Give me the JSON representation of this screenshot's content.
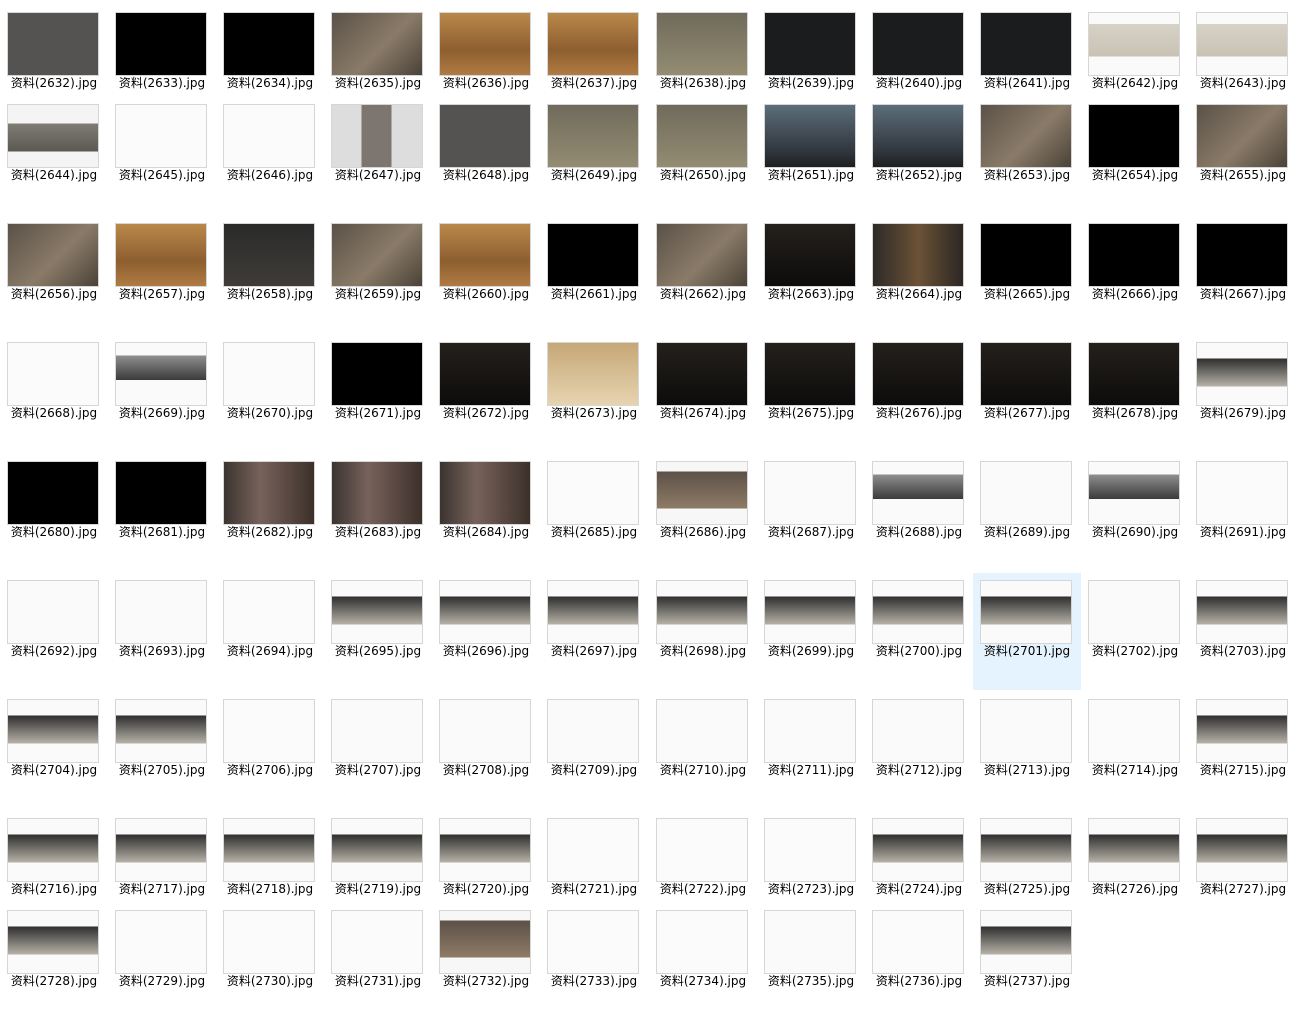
{
  "file_list": {
    "items": [
      {
        "name": "资料(2632).jpg",
        "thumb": "k7"
      },
      {
        "name": "资料(2633).jpg",
        "thumb": "k1"
      },
      {
        "name": "资料(2634).jpg",
        "thumb": "k1"
      },
      {
        "name": "资料(2635).jpg",
        "thumb": "k2"
      },
      {
        "name": "资料(2636).jpg",
        "thumb": "k3"
      },
      {
        "name": "资料(2637).jpg",
        "thumb": "k3"
      },
      {
        "name": "资料(2638).jpg",
        "thumb": "k4"
      },
      {
        "name": "资料(2639).jpg",
        "thumb": "k5"
      },
      {
        "name": "资料(2640).jpg",
        "thumb": "k5"
      },
      {
        "name": "资料(2641).jpg",
        "thumb": "k5"
      },
      {
        "name": "资料(2642).jpg",
        "thumb": "k6"
      },
      {
        "name": "资料(2643).jpg",
        "thumb": "k6"
      },
      {
        "name": "资料(2644).jpg",
        "thumb": "k12"
      },
      {
        "name": "资料(2645).jpg",
        "thumb": "k11"
      },
      {
        "name": "资料(2646).jpg",
        "thumb": "k11"
      },
      {
        "name": "资料(2647).jpg",
        "thumb": "k14"
      },
      {
        "name": "资料(2648).jpg",
        "thumb": "k7"
      },
      {
        "name": "资料(2649).jpg",
        "thumb": "k4"
      },
      {
        "name": "资料(2650).jpg",
        "thumb": "k4"
      },
      {
        "name": "资料(2651).jpg",
        "thumb": "k8"
      },
      {
        "name": "资料(2652).jpg",
        "thumb": "k8"
      },
      {
        "name": "资料(2653).jpg",
        "thumb": "k2"
      },
      {
        "name": "资料(2654).jpg",
        "thumb": "k1"
      },
      {
        "name": "资料(2655).jpg",
        "thumb": "k2"
      },
      {
        "name": "资料(2656).jpg",
        "thumb": "k2"
      },
      {
        "name": "资料(2657).jpg",
        "thumb": "k3"
      },
      {
        "name": "资料(2658).jpg",
        "thumb": "k19"
      },
      {
        "name": "资料(2659).jpg",
        "thumb": "k2"
      },
      {
        "name": "资料(2660).jpg",
        "thumb": "k3"
      },
      {
        "name": "资料(2661).jpg",
        "thumb": "k1"
      },
      {
        "name": "资料(2662).jpg",
        "thumb": "k2"
      },
      {
        "name": "资料(2663).jpg",
        "thumb": "k9"
      },
      {
        "name": "资料(2664).jpg",
        "thumb": "k10"
      },
      {
        "name": "资料(2665).jpg",
        "thumb": "k1"
      },
      {
        "name": "资料(2666).jpg",
        "thumb": "k1"
      },
      {
        "name": "资料(2667).jpg",
        "thumb": "k1"
      },
      {
        "name": "资料(2668).jpg",
        "thumb": "k11"
      },
      {
        "name": "资料(2669).jpg",
        "thumb": "k15"
      },
      {
        "name": "资料(2670).jpg",
        "thumb": "k11"
      },
      {
        "name": "资料(2671).jpg",
        "thumb": "k1"
      },
      {
        "name": "资料(2672).jpg",
        "thumb": "k9"
      },
      {
        "name": "资料(2673).jpg",
        "thumb": "k13"
      },
      {
        "name": "资料(2674).jpg",
        "thumb": "k9"
      },
      {
        "name": "资料(2675).jpg",
        "thumb": "k9"
      },
      {
        "name": "资料(2676).jpg",
        "thumb": "k9"
      },
      {
        "name": "资料(2677).jpg",
        "thumb": "k9"
      },
      {
        "name": "资料(2678).jpg",
        "thumb": "k9"
      },
      {
        "name": "资料(2679).jpg",
        "thumb": "k17"
      },
      {
        "name": "资料(2680).jpg",
        "thumb": "k1"
      },
      {
        "name": "资料(2681).jpg",
        "thumb": "k1"
      },
      {
        "name": "资料(2682).jpg",
        "thumb": "k20"
      },
      {
        "name": "资料(2683).jpg",
        "thumb": "k20"
      },
      {
        "name": "资料(2684).jpg",
        "thumb": "k20"
      },
      {
        "name": "资料(2685).jpg",
        "thumb": "k11"
      },
      {
        "name": "资料(2686).jpg",
        "thumb": "k18"
      },
      {
        "name": "资料(2687).jpg",
        "thumb": "k16"
      },
      {
        "name": "资料(2688).jpg",
        "thumb": "k15"
      },
      {
        "name": "资料(2689).jpg",
        "thumb": "k16"
      },
      {
        "name": "资料(2690).jpg",
        "thumb": "k15"
      },
      {
        "name": "资料(2691).jpg",
        "thumb": "k11"
      },
      {
        "name": "资料(2692).jpg",
        "thumb": "k16"
      },
      {
        "name": "资料(2693).jpg",
        "thumb": "k16"
      },
      {
        "name": "资料(2694).jpg",
        "thumb": "k11"
      },
      {
        "name": "资料(2695).jpg",
        "thumb": "k17"
      },
      {
        "name": "资料(2696).jpg",
        "thumb": "k17"
      },
      {
        "name": "资料(2697).jpg",
        "thumb": "k17"
      },
      {
        "name": "资料(2698).jpg",
        "thumb": "k17"
      },
      {
        "name": "资料(2699).jpg",
        "thumb": "k17"
      },
      {
        "name": "资料(2700).jpg",
        "thumb": "k17"
      },
      {
        "name": "资料(2701).jpg",
        "thumb": "k17"
      },
      {
        "name": "资料(2702).jpg",
        "thumb": "k16"
      },
      {
        "name": "资料(2703).jpg",
        "thumb": "k17"
      },
      {
        "name": "资料(2704).jpg",
        "thumb": "k17"
      },
      {
        "name": "资料(2705).jpg",
        "thumb": "k17"
      },
      {
        "name": "资料(2706).jpg",
        "thumb": "k11"
      },
      {
        "name": "资料(2707).jpg",
        "thumb": "k16"
      },
      {
        "name": "资料(2708).jpg",
        "thumb": "k16"
      },
      {
        "name": "资料(2709).jpg",
        "thumb": "k16"
      },
      {
        "name": "资料(2710).jpg",
        "thumb": "k16"
      },
      {
        "name": "资料(2711).jpg",
        "thumb": "k16"
      },
      {
        "name": "资料(2712).jpg",
        "thumb": "k16"
      },
      {
        "name": "资料(2713).jpg",
        "thumb": "k16"
      },
      {
        "name": "资料(2714).jpg",
        "thumb": "k11"
      },
      {
        "name": "资料(2715).jpg",
        "thumb": "k17"
      },
      {
        "name": "资料(2716).jpg",
        "thumb": "k17"
      },
      {
        "name": "资料(2717).jpg",
        "thumb": "k17"
      },
      {
        "name": "资料(2718).jpg",
        "thumb": "k17"
      },
      {
        "name": "资料(2719).jpg",
        "thumb": "k17"
      },
      {
        "name": "资料(2720).jpg",
        "thumb": "k17"
      },
      {
        "name": "资料(2721).jpg",
        "thumb": "k11"
      },
      {
        "name": "资料(2722).jpg",
        "thumb": "k11"
      },
      {
        "name": "资料(2723).jpg",
        "thumb": "k11"
      },
      {
        "name": "资料(2724).jpg",
        "thumb": "k17"
      },
      {
        "name": "资料(2725).jpg",
        "thumb": "k17"
      },
      {
        "name": "资料(2726).jpg",
        "thumb": "k17"
      },
      {
        "name": "资料(2727).jpg",
        "thumb": "k17"
      },
      {
        "name": "资料(2728).jpg",
        "thumb": "k17"
      },
      {
        "name": "资料(2729).jpg",
        "thumb": "k11"
      },
      {
        "name": "资料(2730).jpg",
        "thumb": "k11"
      },
      {
        "name": "资料(2731).jpg",
        "thumb": "k11"
      },
      {
        "name": "资料(2732).jpg",
        "thumb": "k18"
      },
      {
        "name": "资料(2733).jpg",
        "thumb": "k11"
      },
      {
        "name": "资料(2734).jpg",
        "thumb": "k11"
      },
      {
        "name": "资料(2735).jpg",
        "thumb": "k16"
      },
      {
        "name": "资料(2736).jpg",
        "thumb": "k11"
      },
      {
        "name": "资料(2737).jpg",
        "thumb": "k17"
      }
    ],
    "selected_index": 69,
    "colors": {
      "selection_background": "#e5f3ff",
      "caption_text": "#000000",
      "window_background": "#ffffff"
    }
  }
}
